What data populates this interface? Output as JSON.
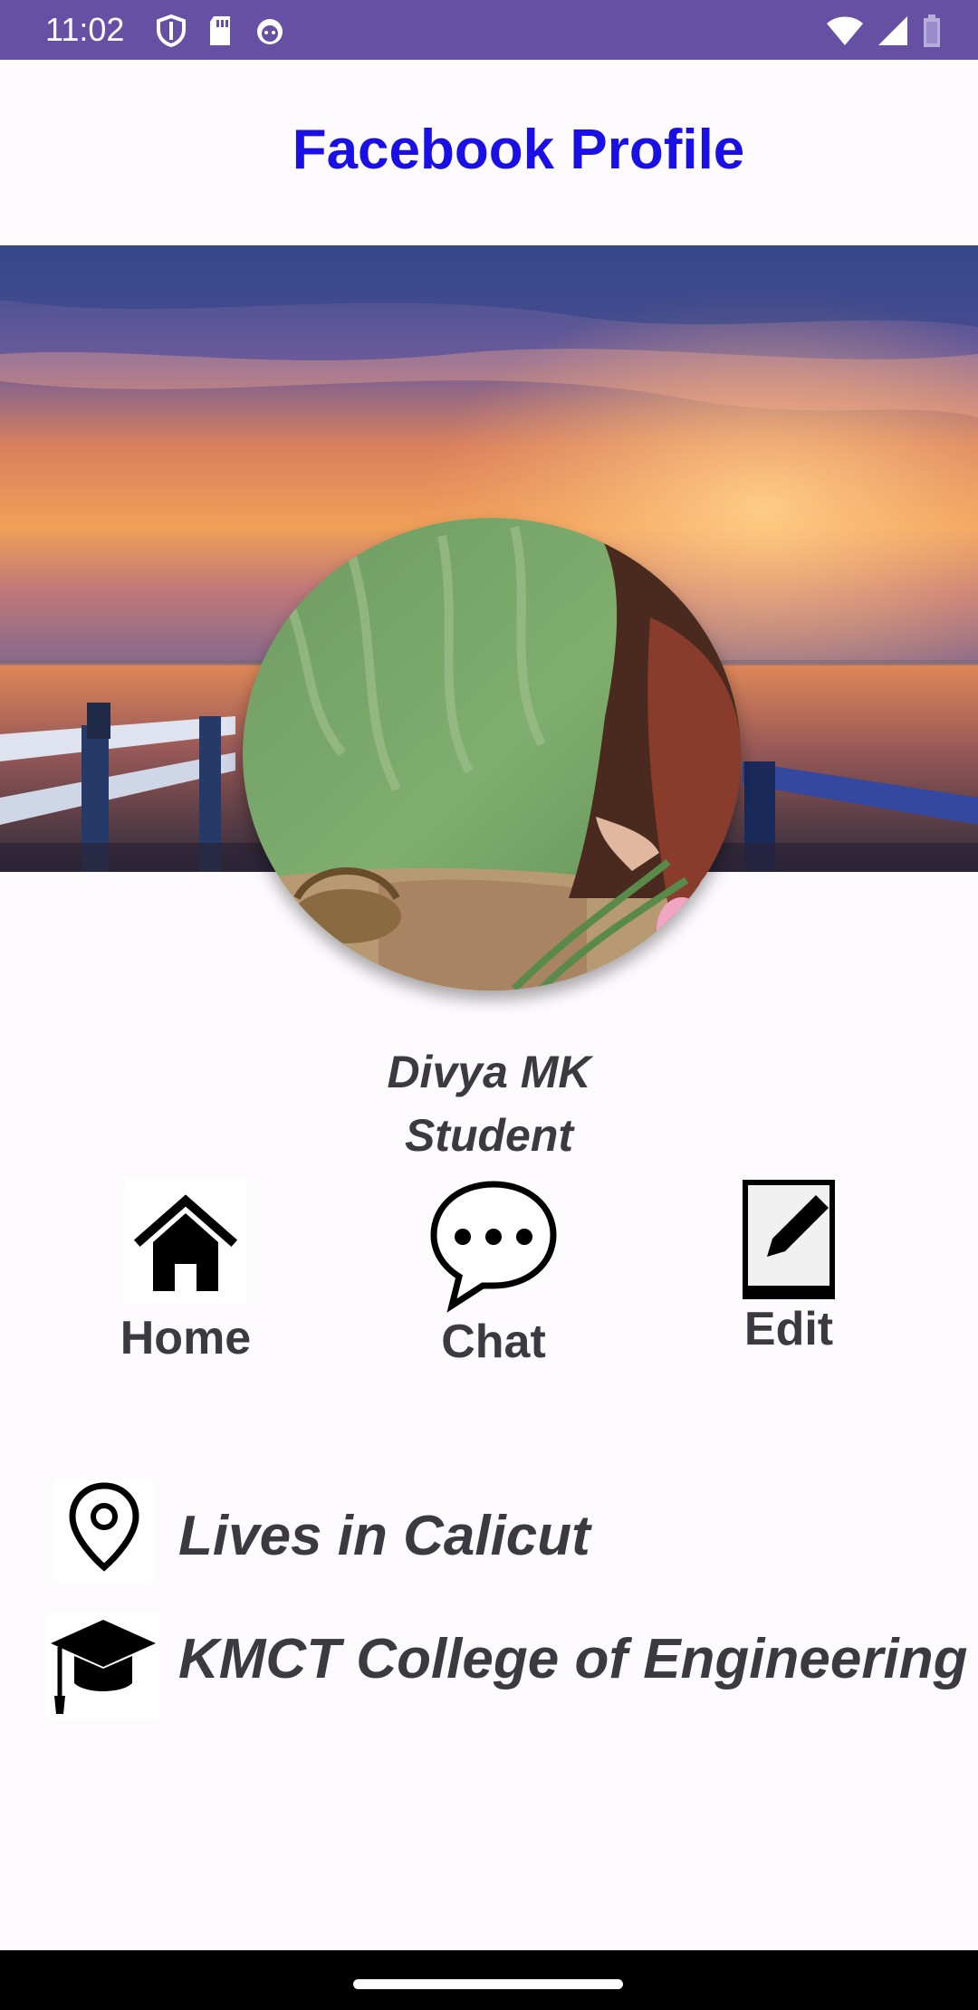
{
  "status_bar": {
    "time": "11:02",
    "left_icons": [
      "shield-icon",
      "sd-card-icon",
      "cat-icon"
    ],
    "right_icons": [
      "wifi-icon",
      "signal-icon",
      "battery-icon"
    ],
    "color": "#6650a4"
  },
  "header": {
    "title": "Facebook Profile",
    "color": "#1a10e6"
  },
  "profile": {
    "name": "Divya MK",
    "role": "Student"
  },
  "actions": [
    {
      "label": "Home",
      "icon": "home-icon"
    },
    {
      "label": "Chat",
      "icon": "chat-icon"
    },
    {
      "label": "Edit",
      "icon": "edit-icon"
    }
  ],
  "info": [
    {
      "text": "Lives in Calicut",
      "icon": "location-pin-icon"
    },
    {
      "text": "KMCT College of Engineering",
      "icon": "graduation-cap-icon"
    }
  ]
}
